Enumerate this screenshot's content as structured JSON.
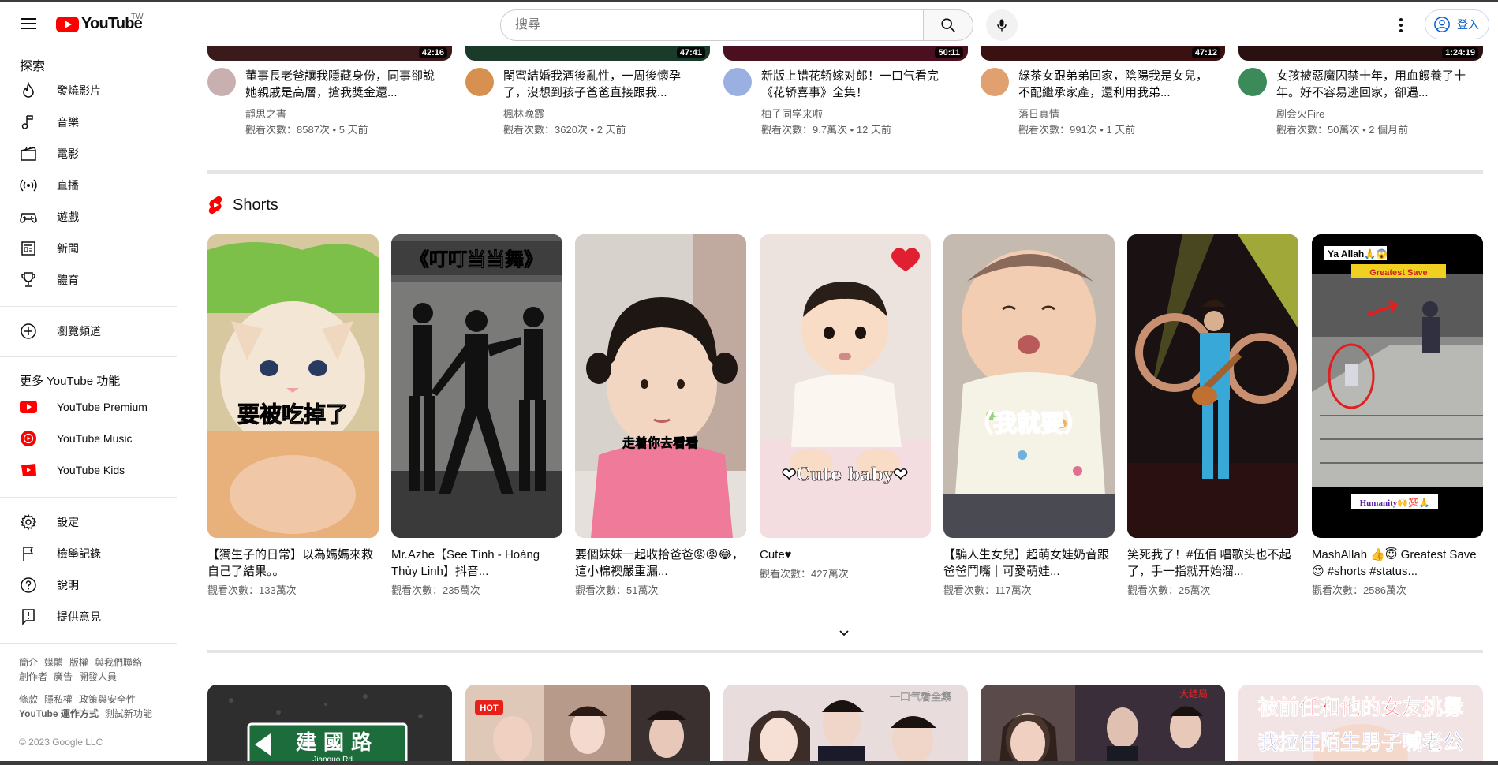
{
  "header": {
    "brand": "YouTube",
    "region": "TW",
    "search_placeholder": "搜尋",
    "signin_label": "登入"
  },
  "sidebar": {
    "explore_heading": "探索",
    "explore": [
      {
        "label": "發燒影片",
        "icon": "trending-icon"
      },
      {
        "label": "音樂",
        "icon": "music-icon"
      },
      {
        "label": "電影",
        "icon": "movie-icon"
      },
      {
        "label": "直播",
        "icon": "live-icon"
      },
      {
        "label": "遊戲",
        "icon": "gaming-icon"
      },
      {
        "label": "新聞",
        "icon": "news-icon"
      },
      {
        "label": "體育",
        "icon": "trophy-icon"
      }
    ],
    "browse_channels": "瀏覽頻道",
    "more_heading": "更多 YouTube 功能",
    "more": [
      {
        "label": "YouTube Premium",
        "icon": "youtube-premium-icon"
      },
      {
        "label": "YouTube Music",
        "icon": "youtube-music-icon"
      },
      {
        "label": "YouTube Kids",
        "icon": "youtube-kids-icon"
      }
    ],
    "settings": [
      {
        "label": "設定",
        "icon": "gear-icon"
      },
      {
        "label": "檢舉記錄",
        "icon": "flag-icon"
      },
      {
        "label": "說明",
        "icon": "help-icon"
      },
      {
        "label": "提供意見",
        "icon": "feedback-icon"
      }
    ],
    "footer_line1": [
      "簡介",
      "媒體",
      "版權",
      "與我們聯絡"
    ],
    "footer_line2": [
      "創作者",
      "廣告",
      "開發人員"
    ],
    "footer_line3": [
      "條款",
      "隱私權",
      "政策與安全性"
    ],
    "footer_line4": [
      "YouTube 運作方式",
      "測試新功能"
    ],
    "copyright": "© 2023 Google LLC"
  },
  "videos": [
    {
      "duration": "42:16",
      "title": "董事長老爸讓我隱藏身份，同事卻說她親戚是高層，搶我獎金還...",
      "channel": "靜思之書",
      "meta": "觀看次數：8587次 • 5 天前",
      "color": "#3a1a1a"
    },
    {
      "duration": "47:41",
      "title": "閨蜜結婚我酒後亂性，一周後懷孕了，沒想到孩子爸爸直接跟我...",
      "channel": "楓林晚霞",
      "meta": "觀看次數：3620次 • 2 天前",
      "color": "#1a3a2a"
    },
    {
      "duration": "50:11",
      "title": "新版上错花轿嫁对郎！一口气看完《花轿喜事》全集！",
      "channel": "柚子同学来啦",
      "meta": "觀看次數：9.7萬次 • 12 天前",
      "color": "#4a1020"
    },
    {
      "duration": "47:12",
      "title": "綠茶女跟弟弟回家，陰陽我是女兒，不配繼承家產，還利用我弟...",
      "channel": "落日真情",
      "meta": "觀看次數：991次 • 1 天前",
      "color": "#3a1010"
    },
    {
      "duration": "1:24:19",
      "title": "女孩被惡魔囚禁十年，用血饅養了十年。好不容易逃回家，卻遇...",
      "channel": "剧会火Fire",
      "meta": "觀看次數：50萬次 • 2 個月前",
      "color": "#2a1010"
    }
  ],
  "shorts": {
    "heading": "Shorts",
    "items": [
      {
        "title": "【獨生子的日常】以為媽媽來救自己了結果。。",
        "views": "觀看次數：133萬次",
        "overlay": "要被吃掉了",
        "bg": "#e8d9c0"
      },
      {
        "title": "Mr.Azhe【See Tình - Hoàng Thùy Linh】抖音...",
        "views": "觀看次數：235萬次",
        "overlay": "《叮叮当当舞》",
        "bg": "#2a2a2a"
      },
      {
        "title": "要個妹妹一起收拾爸爸😡😡😂，這小棉襖嚴重漏...",
        "views": "觀看次數：51萬次",
        "overlay": "走着你去看看",
        "bg": "#c8c0b8"
      },
      {
        "title": "Cute♥",
        "views": "觀看次數：427萬次",
        "overlay": "❤Cute baby❤",
        "bg": "#e6dcd8"
      },
      {
        "title": "【騙人生女兒】超萌女娃奶音跟爸爸鬥嘴｜可愛萌娃...",
        "views": "觀看次數：117萬次",
        "overlay": "（我就要）",
        "bg": "#d0c8c0"
      },
      {
        "title": "笑死我了！#伍佰 唱歌头也不起了，手一指就开始溜...",
        "views": "觀看次數：25萬次",
        "overlay": "",
        "bg": "#2a1a1a"
      },
      {
        "title": "MashAllah 👍😇 Greatest Save 😍 #shorts #status...",
        "views": "觀看次數：2586萬次",
        "overlay": "Greatest Save",
        "bg": "#1a1a1a"
      }
    ]
  },
  "bottom_thumbs": [
    {
      "text": "建 國 路",
      "sub": "Jianguo Rd.",
      "bg": "#3a3a3a"
    },
    {
      "text": "HOT",
      "sub": "",
      "bg": "#d8c8c0"
    },
    {
      "text": "一口气看全集",
      "sub": "",
      "bg": "#e8e0e0"
    },
    {
      "text": "大结局",
      "sub": "",
      "bg": "#6a5a5a"
    },
    {
      "text": "被前任和他的女友挑釁",
      "sub": "我拉住陌生男子喊老公",
      "bg": "#f0e0e0"
    }
  ]
}
